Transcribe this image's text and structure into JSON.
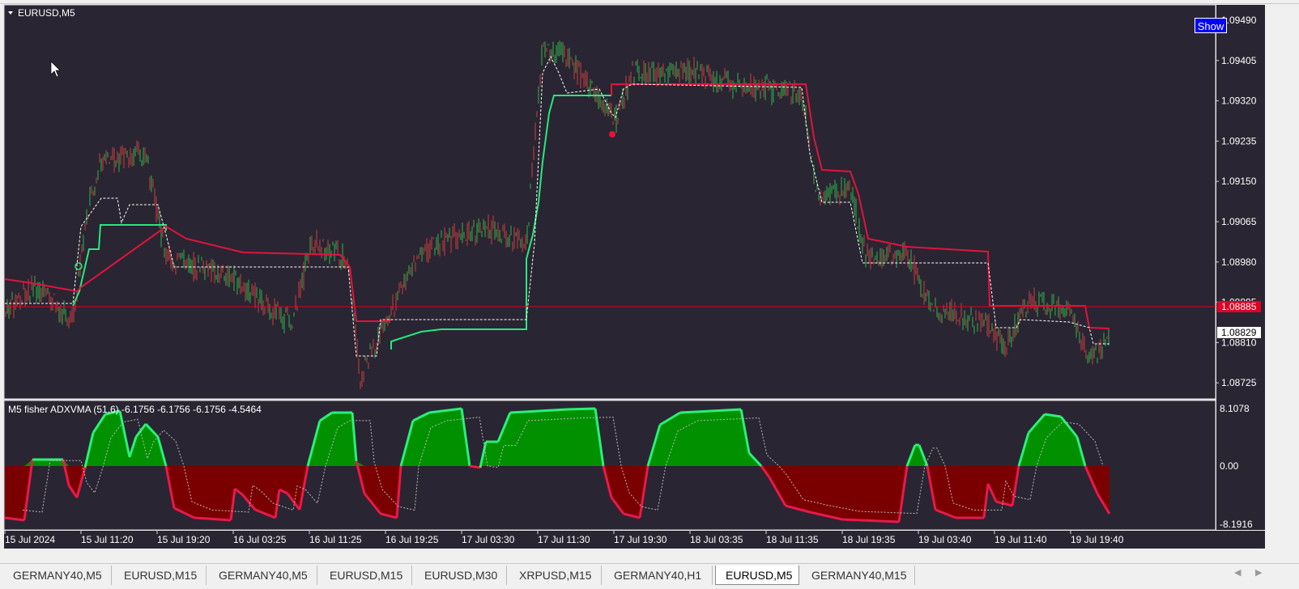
{
  "window": {
    "title": "EURUSD,M5",
    "show_button": "Show"
  },
  "main_chart": {
    "symbol_label": "EURUSD,M5",
    "price_ticks": [
      "1.09490",
      "1.09405",
      "1.09320",
      "1.09235",
      "1.09150",
      "1.09065",
      "1.08980",
      "1.08895",
      "1.08810",
      "1.08725"
    ],
    "current_price_label": "1.08885",
    "current_price_color": "#e00020",
    "bid_label": "1.08829",
    "bull_line_color": "#27e87d",
    "bear_line_color": "#e0143c"
  },
  "indicator": {
    "label": "M5 fisher ADXVMA (51,6) -6.1756 -6.1756 -6.1756 -4.5464",
    "ticks": [
      "8.1078",
      "0.00",
      "-8.1916"
    ],
    "up_fill_color": "#009000",
    "down_fill_color": "#7a0000"
  },
  "time_axis": [
    "15 Jul 2024",
    "15 Jul 11:20",
    "15 Jul 19:20",
    "16 Jul 03:25",
    "16 Jul 11:25",
    "16 Jul 19:25",
    "17 Jul 03:30",
    "17 Jul 11:30",
    "17 Jul 19:30",
    "18 Jul 03:35",
    "18 Jul 11:35",
    "18 Jul 19:35",
    "19 Jul 03:40",
    "19 Jul 11:40",
    "19 Jul 19:40"
  ],
  "tabs": [
    "GERMANY40,M5",
    "EURUSD,M15",
    "GERMANY40,M5",
    "EURUSD,M15",
    "EURUSD,M30",
    "XRPUSD,M15",
    "GERMANY40,H1",
    "EURUSD,M5",
    "GERMANY40,M15"
  ],
  "active_tab_index": 7
}
